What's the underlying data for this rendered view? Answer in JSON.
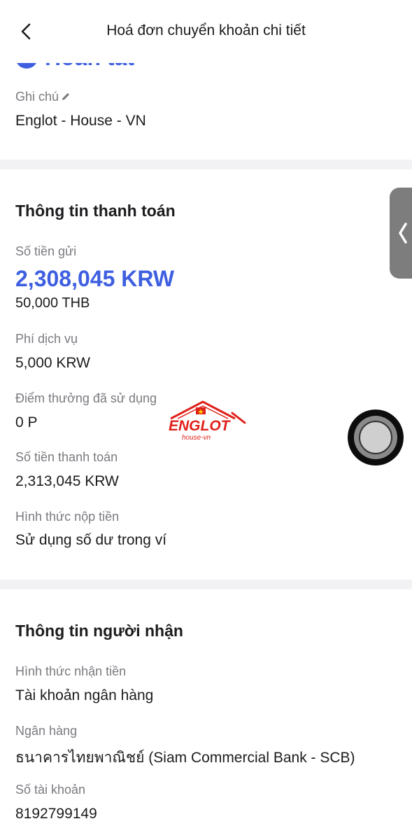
{
  "header": {
    "title": "Hoá đơn chuyển khoản chi tiết"
  },
  "status": {
    "text": "Hoàn tất"
  },
  "note": {
    "label": "Ghi chú",
    "value": "Englot - House - VN"
  },
  "payment": {
    "title": "Thông tin thanh toán",
    "deposit_label": "Số tiền gửi",
    "deposit_amount": "2,308,045 KRW",
    "deposit_converted": "50,000 THB",
    "fee_label": "Phí dịch vụ",
    "fee_value": "5,000 KRW",
    "points_label": "Điểm thưởng đã sử dụng",
    "points_value": "0 P",
    "total_label": "Số tiền thanh toán",
    "total_value": "2,313,045 KRW",
    "method_label": "Hình thức nộp tiền",
    "method_value": "Sử dụng số dư trong ví"
  },
  "recipient": {
    "title": "Thông tin người nhận",
    "receive_method_label": "Hình thức nhận tiền",
    "receive_method_value": "Tài khoản ngân hàng",
    "bank_label": "Ngân hàng",
    "bank_value": "ธนาคารไทยพาณิชย์ (Siam Commercial Bank - SCB)",
    "account_label": "Số tài khoản",
    "account_value": "8192799149"
  },
  "watermark": {
    "brand": "ENGLOT",
    "sub": "house-vn"
  },
  "colors": {
    "accent": "#3e5fe0",
    "divider": "#f2f2f5",
    "watermark": "#e0201a"
  },
  "icons": {
    "back": "chevron-left-icon",
    "edit": "pencil-icon",
    "side_tab": "chevron-left-icon",
    "float": "assistive-touch-icon"
  }
}
